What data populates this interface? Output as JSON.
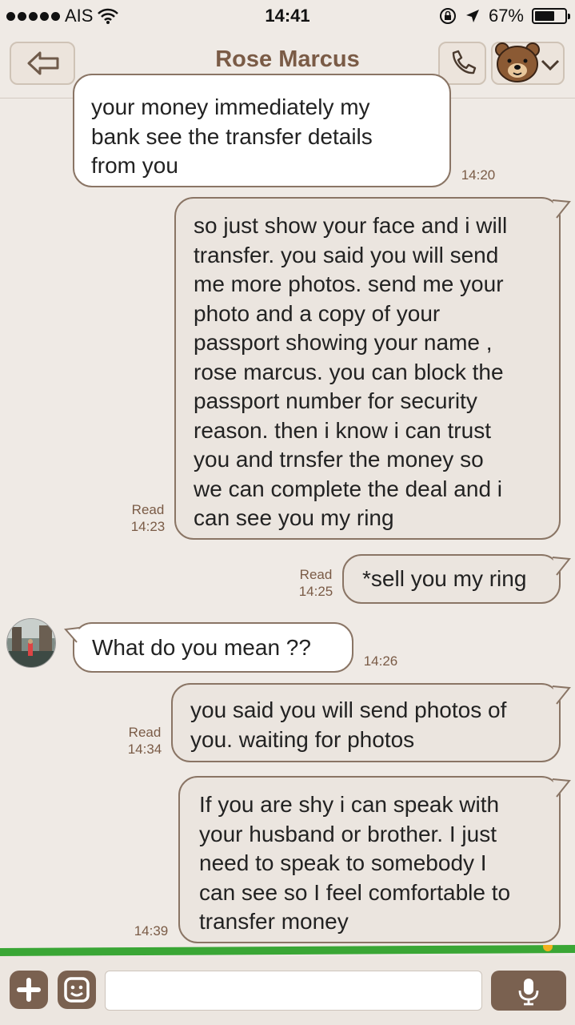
{
  "status_bar": {
    "carrier": "AIS",
    "time": "14:41",
    "battery": "67%",
    "battery_level": 0.67
  },
  "header": {
    "title": "Rose Marcus",
    "page_dots": 3,
    "active_dot": 0
  },
  "messages": [
    {
      "direction": "in",
      "lines": [
        "your money immediately my",
        "bank see the transfer details",
        "from you"
      ],
      "time": "14:20"
    },
    {
      "direction": "out",
      "lines": [
        "so just show your face and i will",
        "transfer.  you said you will send",
        "me more photos. send me your",
        "photo and a copy of your",
        "passport showing your name ,",
        "rose marcus. you can block the",
        "passport number for security",
        "reason. then i know i can trust",
        "you and trnsfer the money so",
        "we can complete the deal and i",
        "can see you my ring"
      ],
      "status": "Read",
      "time": "14:23"
    },
    {
      "direction": "out",
      "lines": [
        "*sell you my ring"
      ],
      "status": "Read",
      "time": "14:25"
    },
    {
      "direction": "in",
      "lines": [
        "What do you mean ??"
      ],
      "time": "14:26"
    },
    {
      "direction": "out",
      "lines": [
        "you said you will send photos of",
        "you. waiting for photos"
      ],
      "status": "Read",
      "time": "14:34"
    },
    {
      "direction": "out",
      "lines": [
        "If you are shy i can speak with",
        "your husband or brother. I just",
        "need to speak to somebody I",
        "can see so I feel comfortable to",
        "transfer money"
      ],
      "time": "14:39"
    }
  ],
  "input": {
    "placeholder": ""
  },
  "icons": {
    "back": "back-arrow-icon",
    "call": "phone-icon",
    "sticker": "bear-sticker-icon",
    "menu": "chevron-down-icon",
    "add": "plus-icon",
    "emoji": "smiley-icon",
    "mic": "microphone-icon"
  },
  "colors": {
    "background": "#efeae5",
    "title": "#7a5b46",
    "bubble_border": "#8a7565",
    "incoming_bubble": "#ffffff",
    "outgoing_bubble": "#ebe5df",
    "button": "#7a6150",
    "green_bar": "#3aa635"
  }
}
